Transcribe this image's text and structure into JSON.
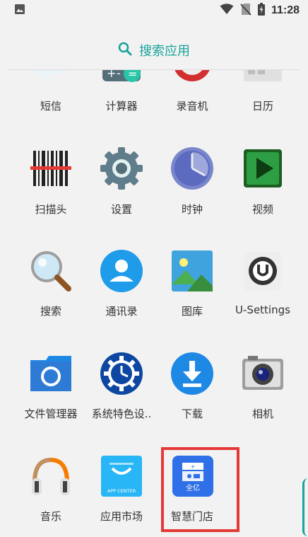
{
  "status_bar": {
    "time": "11:28",
    "icons": [
      "image-icon",
      "wifi-icon",
      "no-sim-icon",
      "battery-icon"
    ]
  },
  "search": {
    "label": "搜索应用",
    "icon": "search-icon"
  },
  "apps": [
    {
      "label": "短信",
      "icon": "messages-icon"
    },
    {
      "label": "计算器",
      "icon": "calculator-icon"
    },
    {
      "label": "录音机",
      "icon": "recorder-icon"
    },
    {
      "label": "日历",
      "icon": "calendar-icon"
    },
    {
      "label": "扫描头",
      "icon": "barcode-scanner-icon"
    },
    {
      "label": "设置",
      "icon": "gear-icon"
    },
    {
      "label": "时钟",
      "icon": "clock-icon"
    },
    {
      "label": "视频",
      "icon": "video-icon"
    },
    {
      "label": "搜索",
      "icon": "magnifier-icon"
    },
    {
      "label": "通讯录",
      "icon": "contacts-icon"
    },
    {
      "label": "图库",
      "icon": "gallery-icon"
    },
    {
      "label": "U-Settings",
      "icon": "u-settings-icon"
    },
    {
      "label": "文件管理器",
      "icon": "folder-icon"
    },
    {
      "label": "系统特色设..",
      "icon": "system-features-icon"
    },
    {
      "label": "下载",
      "icon": "download-icon"
    },
    {
      "label": "相机",
      "icon": "camera-icon"
    },
    {
      "label": "音乐",
      "icon": "headphones-icon"
    },
    {
      "label": "应用市场",
      "icon": "app-center-icon"
    },
    {
      "label": "智慧门店",
      "icon": "smart-store-icon"
    }
  ],
  "app_center_text": "APP CENTER",
  "smart_store_badge": "全亿",
  "colors": {
    "accent": "#1aa39a",
    "highlight": "#e53935",
    "background": "#f2f2f2"
  }
}
